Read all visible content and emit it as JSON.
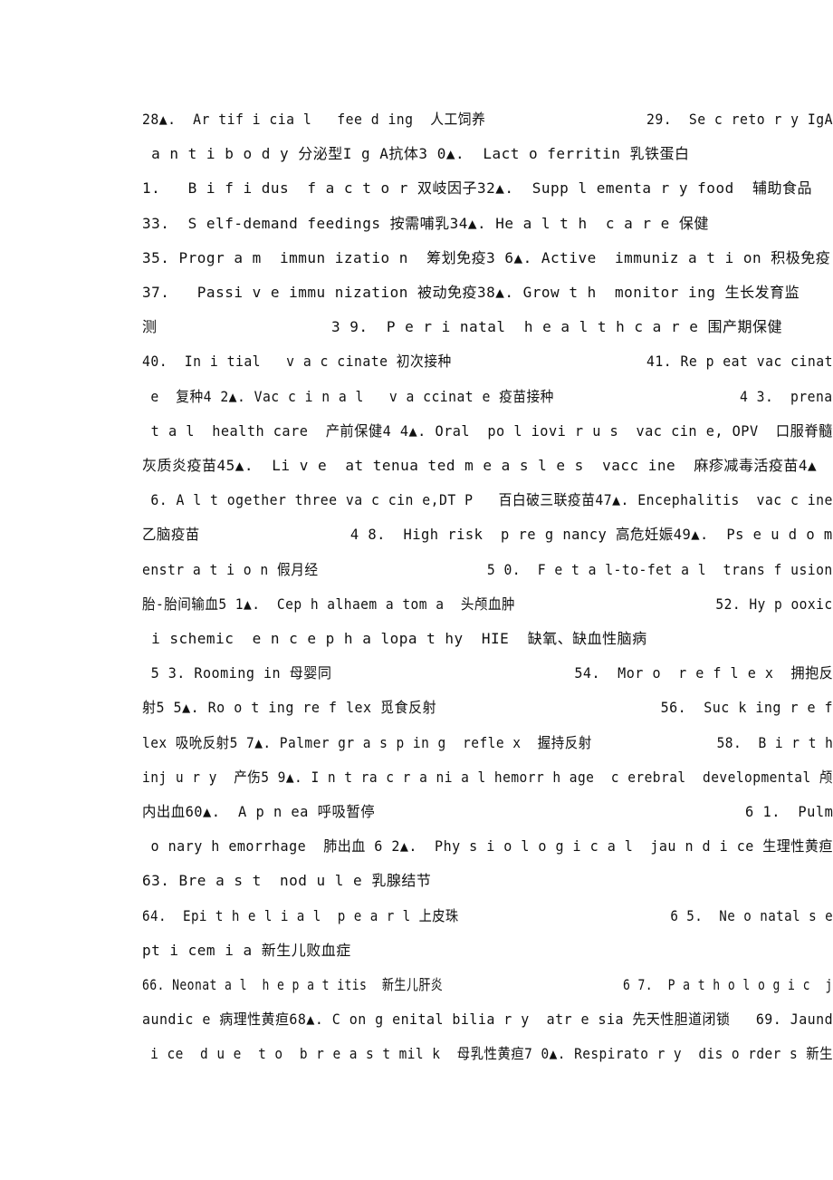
{
  "document": {
    "lines": [
      {
        "text": "28▲.  Ar tif i cia l   fee d ing  人工饲养                   29.  Se c reto r y IgA"
      },
      {
        "text": " a n t i b o d y 分泌型I g A抗体3 0▲.  Lact o ferritin 乳铁蛋白"
      },
      {
        "text": "1.   B i f i dus  f a c t o r 双岐因子32▲.  Supp l ementa r y food  辅助食品"
      },
      {
        "text": "33.  S elf-demand feedings 按需哺乳34▲. He a l t h  c a r e 保健"
      },
      {
        "text": "35. Progr a m  immun izatio n  筹划免疫3 6▲. Active  immuniz a t i on 积极免疫"
      },
      {
        "text": "37.   Passi v e immu nization 被动免疫38▲. Grow t h  monitor ing 生长发育监"
      },
      {
        "text": "测                   3 9.  P e r i natal  h e a l t h c a r e 围产期保健"
      },
      {
        "text": "40.  In i tial   v a c cinate 初次接种                       41. Re p eat vac cinat"
      },
      {
        "text": " e  复种4 2▲. Vac c i n a l   v a ccinat e 疫苗接种                      4 3.  prena"
      },
      {
        "text": " t a l  health care  产前保健4 4▲. Oral  po l iovi r u s  vac cin e, OPV  口服脊髓"
      },
      {
        "text": "灰质炎疫苗45▲.  Li v e  at tenua ted m e a s l e s  vacc ine  麻疹减毒活疫苗4▲"
      },
      {
        "text": " 6. A l t ogether three va c cin e,DT P   百白破三联疫苗47▲. Encephalitis  vac c ine"
      },
      {
        "text": "乙脑疫苗                 4 8.  High risk  p re g nancy 高危妊娠49▲.  Ps e u d o m"
      },
      {
        "text": "enstr a t i o n 假月经                    5 0.  F e t a l-to-fet a l  trans f usion"
      },
      {
        "text": "胎-胎间输血5 1▲.  Cep h alhaem a tom a  头颅血肿                        52. Hy p ooxic"
      },
      {
        "text": " i schemic  e n c e p h a lopa t hy  HIE  缺氧、缺血性脑病"
      },
      {
        "text": " 5 3. Rooming in 母婴同                            54.  Mor o  r e f l e x  拥抱反"
      },
      {
        "text": "射5 5▲. Ro o t ing re f lex 觅食反射                          56.  Suc k ing r e f"
      },
      {
        "text": "lex 吸吮反射5 7▲. Palmer gr a s p in g  refle x  握持反射               58.  B i r t h"
      },
      {
        "text": "inj u r y  产伤5 9▲. I n t ra c r a ni a l hemorr h age  c erebral  developmental 颅"
      },
      {
        "text": "内出血60▲.  A p n ea 呼吸暂停                                          6 1.  Pulm"
      },
      {
        "text": " o nary h emorrhage  肺出血 6 2▲.  Phy s i o l o g i c a l  jau n d i ce 生理性黄疸"
      },
      {
        "text": "63. Bre a s t  nod u l e 乳腺结节"
      },
      {
        "text": "64.  Epi t h e l i a l  p e a r l 上皮珠                          6 5.  Ne o natal s e"
      },
      {
        "text": "pt i cem i a 新生儿败血症"
      },
      {
        "text": "66. Neonat a l  h e p a t itis  新生儿肝炎                        6 7.  P a t h o l o g i c  j"
      },
      {
        "text": "aundic e 病理性黄疸68▲. C on g enital bilia r y  atr e sia 先天性胆道闭锁   69. Jaund"
      },
      {
        "text": " i ce  d u e  t o  b r e a s t mil k  母乳性黄疸7 0▲. Respirato r y  dis o rder s 新生"
      }
    ]
  }
}
